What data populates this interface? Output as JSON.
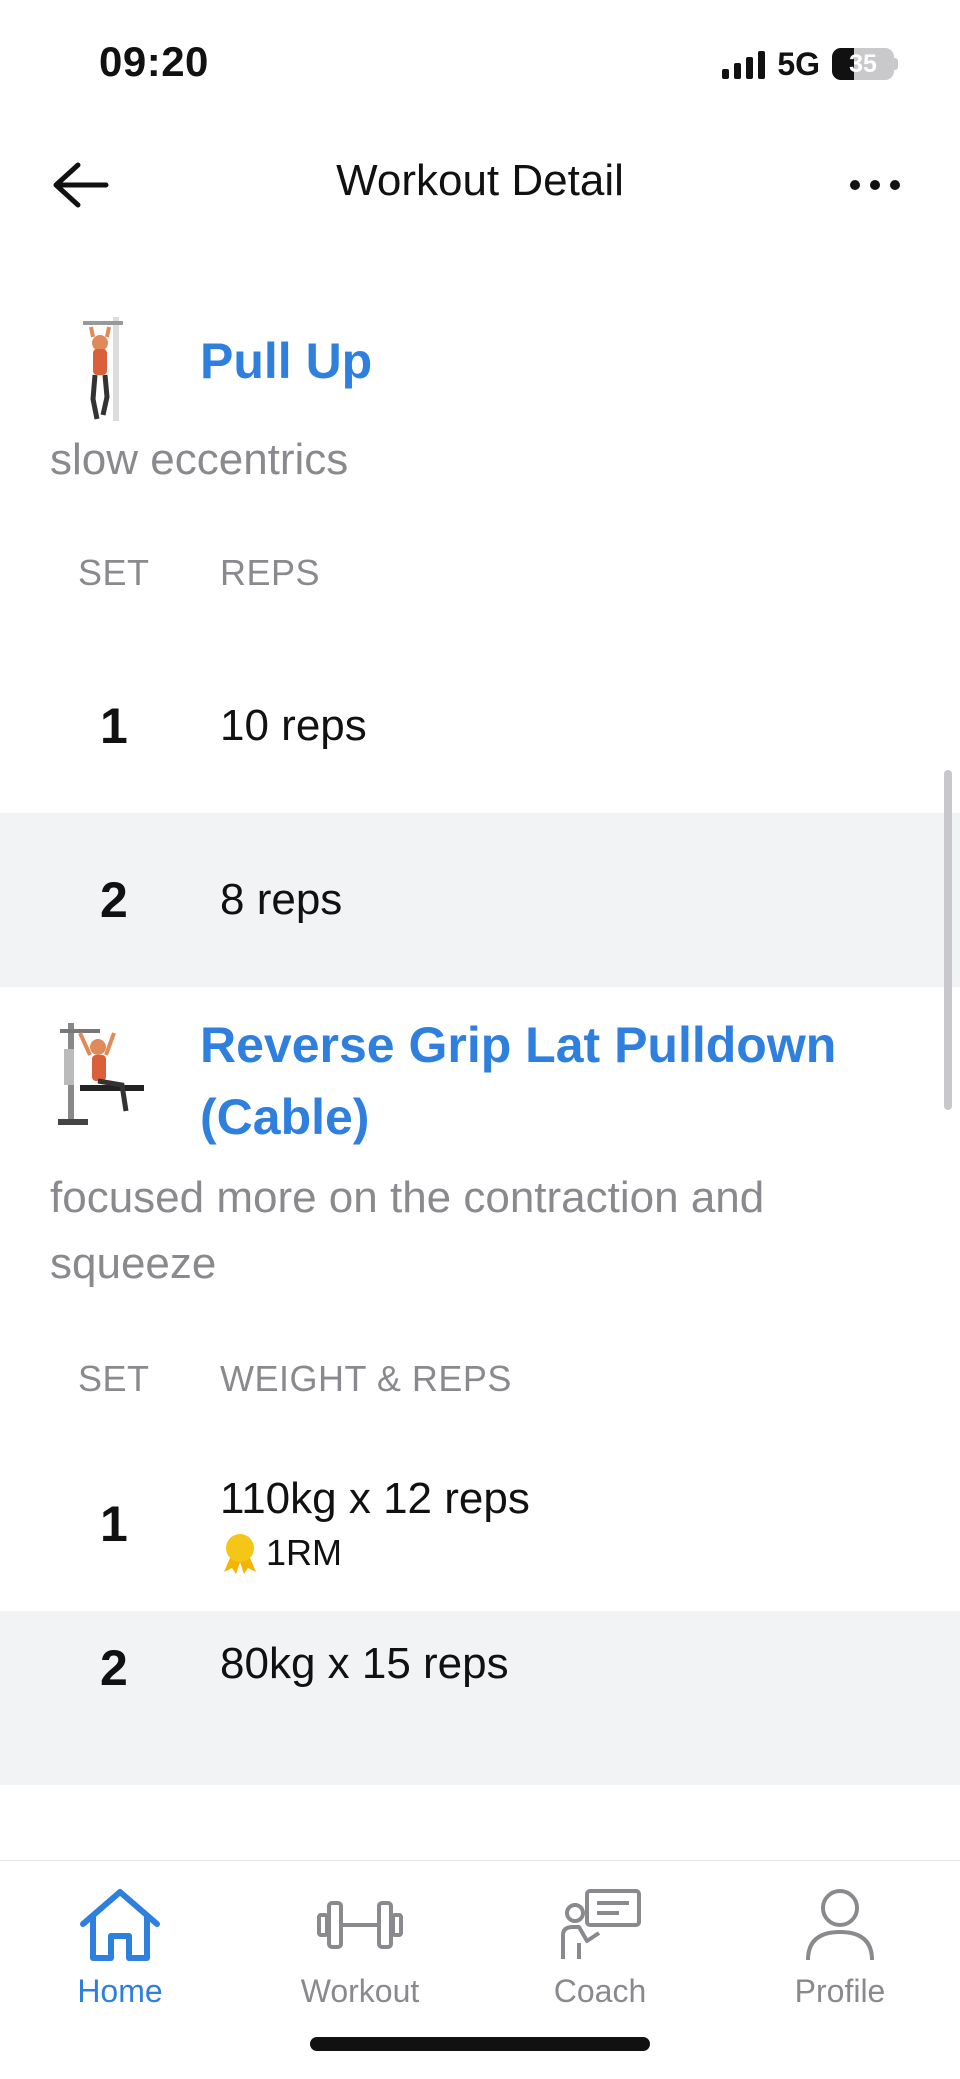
{
  "status_bar": {
    "time": "09:20",
    "network": "5G",
    "battery": "35"
  },
  "header": {
    "title": "Workout Detail"
  },
  "exercises": [
    {
      "name": "Pull Up",
      "note": "slow eccentrics",
      "columns": [
        "SET",
        "REPS"
      ],
      "sets": [
        {
          "num": "1",
          "value": "10 reps"
        },
        {
          "num": "2",
          "value": "8 reps"
        }
      ]
    },
    {
      "name_line1": "Reverse Grip Lat Pulldown",
      "name_line2": "(Cable)",
      "note_line1": "focused more on the contraction and",
      "note_line2": "squeeze",
      "columns": [
        "SET",
        "WEIGHT & REPS"
      ],
      "sets": [
        {
          "num": "1",
          "value": "110kg x 12 reps",
          "badge": "1RM"
        },
        {
          "num": "2",
          "value": "80kg x 15 reps"
        }
      ]
    }
  ],
  "tabs": [
    {
      "label": "Home",
      "icon": "home-icon",
      "active": true
    },
    {
      "label": "Workout",
      "icon": "dumbbell-icon"
    },
    {
      "label": "Coach",
      "icon": "coach-icon"
    },
    {
      "label": "Profile",
      "icon": "profile-icon"
    }
  ],
  "colors": {
    "accent": "#2f7fdf",
    "muted": "#8a8a8e",
    "row_alt": "#f2f3f5",
    "medal": "#f5c518"
  }
}
